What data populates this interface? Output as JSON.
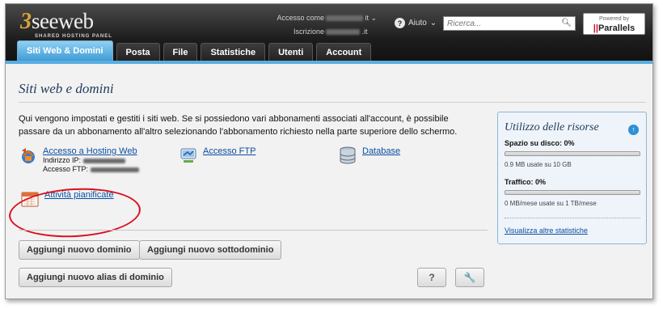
{
  "header": {
    "logo_mark": "3",
    "logo_word": "seeweb",
    "logo_sub": "SHARED HOSTING PANEL",
    "account_label": "Accesso come",
    "account_value_suffix": "it",
    "registration_label": "Iscrizione",
    "registration_value_suffix": ".it",
    "help_label": "Aiuto",
    "search_placeholder": "Ricerca...",
    "powered_by": "Powered by",
    "parallels": "Parallels"
  },
  "tabs": [
    {
      "label": "Siti Web & Domini",
      "active": true
    },
    {
      "label": "Posta"
    },
    {
      "label": "File"
    },
    {
      "label": "Statistiche"
    },
    {
      "label": "Utenti"
    },
    {
      "label": "Account"
    }
  ],
  "main": {
    "title": "Siti web e domini",
    "intro": "Qui vengono impostati e gestiti i siti web. Se si possiedono vari abbonamenti associati all'account, è possibile passare da un abbonamento all'altro selezionando l'abbonamento richiesto nella parte superiore dello schermo.",
    "hosting_link": "Accesso a Hosting Web",
    "ip_label": "Indirizzo IP:",
    "ftp_access_label": "Accesso FTP:",
    "ftp_link": "Accesso FTP",
    "database_link": "Database",
    "scheduled_link": "Attività pianificate",
    "buttons": {
      "add_domain": "Aggiungi nuovo dominio",
      "add_subdomain": "Aggiungi nuovo sottodominio",
      "add_alias": "Aggiungi nuovo alias di dominio",
      "help": "?",
      "tools": "🔧"
    }
  },
  "resources": {
    "title": "Utilizzo delle risorse",
    "disk_label": "Spazio su disco: 0%",
    "disk_percent": 0,
    "disk_usage": "0.9 MB usate su 10 GB",
    "traffic_label": "Traffico: 0%",
    "traffic_percent": 0,
    "traffic_usage": "0 MB/mese usate su 1 TB/mese",
    "more_stats": "Visualizza altre statistiche"
  },
  "colors": {
    "tab_active": "#3d9ad4",
    "link": "#0b4ea2",
    "highlight_ellipse": "#d8101e"
  }
}
